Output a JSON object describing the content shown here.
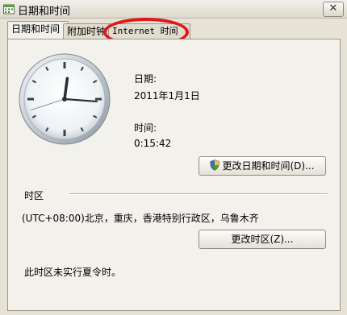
{
  "window": {
    "title": "日期和时间",
    "close_glyph": "✕"
  },
  "tabs": [
    {
      "label": "日期和时间"
    },
    {
      "label": "附加时钟"
    },
    {
      "label": "Internet 时间"
    }
  ],
  "clock": {
    "hour": 0,
    "minute": 15,
    "second": 42
  },
  "date": {
    "label": "日期:",
    "value": "2011年1月1日"
  },
  "time": {
    "label": "时间:",
    "value": "0:15:42"
  },
  "buttons": {
    "change_datetime": "更改日期和时间(D)...",
    "change_timezone": "更改时区(Z)..."
  },
  "timezone": {
    "section_label": "时区",
    "value": "(UTC+08:00)北京，重庆，香港特别行政区，乌鲁木齐",
    "dst_note": "此时区未实行夏令时。"
  },
  "icons": {
    "title": "datetime-app-icon",
    "button": "uac-shield-icon"
  },
  "colors": {
    "annotation": "#e01818"
  }
}
